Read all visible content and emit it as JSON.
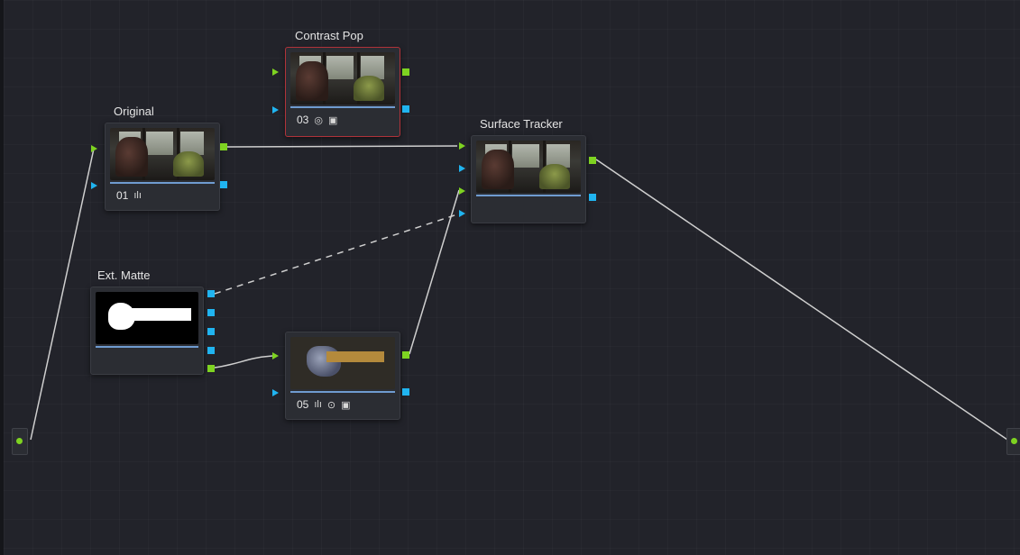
{
  "nodes": {
    "original": {
      "title": "Original",
      "number": "01",
      "icons": [
        "histogram-icon"
      ]
    },
    "contrast_pop": {
      "title": "Contrast Pop",
      "number": "03",
      "icons": [
        "color-wheel-icon",
        "window-icon"
      ]
    },
    "surface_tracker": {
      "title": "Surface Tracker"
    },
    "ext_matte": {
      "title": "Ext. Matte"
    },
    "node_05": {
      "title": "",
      "number": "05",
      "icons": [
        "histogram-icon",
        "circle-window-icon",
        "window-icon"
      ]
    }
  },
  "colors": {
    "rgb_port": "#7ed321",
    "alpha_port": "#20b4f0",
    "selected_border": "#b0333a",
    "link_line": "#cfcfcf",
    "canvas_bg": "#22232a"
  },
  "glyphs": {
    "histogram": "ılı",
    "color_wheel": "◎",
    "window": "▣",
    "circle_window": "⊙"
  }
}
